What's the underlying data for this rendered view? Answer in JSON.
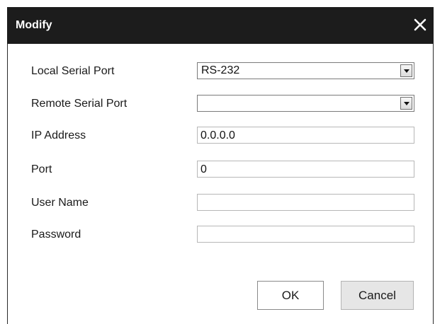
{
  "dialog": {
    "title": "Modify",
    "close_icon": "close-icon"
  },
  "form": {
    "local_serial_port": {
      "label": "Local Serial Port",
      "value": "RS-232"
    },
    "remote_serial_port": {
      "label": "Remote Serial Port",
      "value": ""
    },
    "ip_address": {
      "label": "IP Address",
      "value": "0.0.0.0"
    },
    "port": {
      "label": "Port",
      "value": "0"
    },
    "user_name": {
      "label": "User Name",
      "value": ""
    },
    "password": {
      "label": "Password",
      "value": ""
    }
  },
  "buttons": {
    "ok_label": "OK",
    "cancel_label": "Cancel"
  },
  "colors": {
    "titlebar": "#1c1c1c",
    "title_text": "#ffffff",
    "field_border": "#b7b7b7",
    "cancel_bg": "#e6e6e6"
  }
}
